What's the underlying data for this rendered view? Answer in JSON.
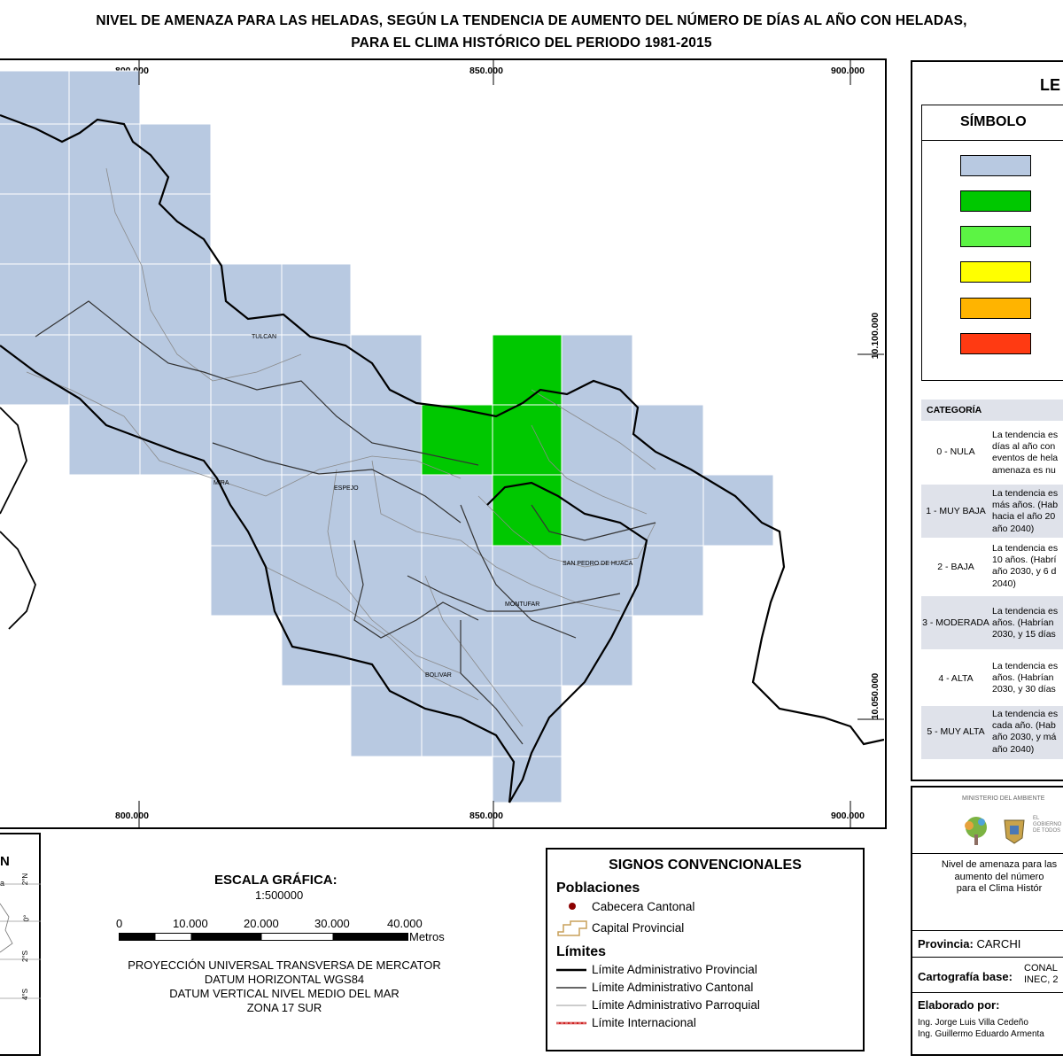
{
  "title": {
    "line1": "NIVEL DE AMENAZA PARA LAS HELADAS, SEGÚN LA TENDENCIA DE AUMENTO DEL NÚMERO DE DÍAS AL AÑO CON HELADAS,",
    "line2": "PARA EL CLIMA HISTÓRICO DEL PERIODO 1981-2015"
  },
  "map": {
    "x_ticks": [
      "800.000",
      "850.000",
      "900.000"
    ],
    "y_ticks": [
      "10.100.000",
      "10.050.000"
    ],
    "labels": {
      "tulcan": "TULCAN",
      "mira": "MIRA",
      "espejo": "ESPEJO",
      "san_pedro": "SAN PEDRO DE HUACA",
      "montufar": "MONTUFAR",
      "bolivar": "BOLIVAR"
    },
    "colors": {
      "nula": "#b8c9e1",
      "muy_baja": "#00c800",
      "baja": "#5cf444",
      "moderada": "#ffff00",
      "alta": "#ffb400",
      "muy_alta": "#ff3a12"
    }
  },
  "inset": {
    "title": "N",
    "label": "a",
    "lat_ticks": [
      "2°N",
      "0°",
      "2°S",
      "4°S"
    ]
  },
  "scale": {
    "title": "ESCALA GRÁFICA:",
    "ratio": "1:500000",
    "ticks": [
      "0",
      "10.000",
      "20.000",
      "30.000",
      "40.000"
    ],
    "unit": "Metros",
    "proj1": "PROYECCIÓN UNIVERSAL TRANSVERSA DE MERCATOR",
    "proj2": "DATUM HORIZONTAL WGS84",
    "proj3": "DATUM VERTICAL NIVEL MEDIO DEL MAR",
    "proj4": "ZONA 17 SUR"
  },
  "signs": {
    "title": "SIGNOS CONVENCIONALES",
    "poblaciones": "Poblaciones",
    "cabecera": "Cabecera Cantonal",
    "capital": "Capital Provincial",
    "limites": "Límites",
    "provincial": "Límite Administrativo Provincial",
    "cantonal": "Límite Administrativo Cantonal",
    "parroquial": "Límite Administrativo Parroquial",
    "internacional": "Límite Internacional"
  },
  "legend": {
    "title": "LE",
    "symbol_header": "SÍMBOLO",
    "category_header": "CATEGORÍA",
    "rows": [
      {
        "cat": "0 - NULA",
        "desc": [
          "La tendencia es",
          "días al año con",
          "eventos de hela",
          "amenaza es nu"
        ]
      },
      {
        "cat": "1 - MUY BAJA",
        "desc": [
          "La tendencia es",
          "más años. (Hab",
          "hacia el año 20",
          "año 2040)"
        ]
      },
      {
        "cat": "2 - BAJA",
        "desc": [
          "La tendencia es",
          "10 años. (Habrí",
          "año 2030, y 6 d",
          "2040)"
        ]
      },
      {
        "cat": "3 - MODERADA",
        "desc": [
          "La tendencia es",
          "años. (Habrían",
          "2030, y 15 días"
        ]
      },
      {
        "cat": "4 - ALTA",
        "desc": [
          "La tendencia es",
          "años. (Habrían",
          "2030, y 30 días"
        ]
      },
      {
        "cat": "5 - MUY ALTA",
        "desc": [
          "La tendencia es",
          "cada año. (Hab",
          "año 2030, y má",
          "año 2040)"
        ]
      }
    ]
  },
  "info": {
    "ministerio": "MINISTERIO DEL AMBIENTE",
    "gobierno1": "EL",
    "gobierno2": "GOBIERNO",
    "gobierno3": "DE TODOS",
    "map_title1": "Nivel de amenaza para las",
    "map_title2": "aumento del número",
    "map_title3": "para el Clima Histór",
    "provincia_label": "Provincia:",
    "provincia_value": "CARCHI",
    "cartografia_label": "Cartografía base:",
    "cartografia_value1": "CONAL",
    "cartografia_value2": "INEC, 2",
    "elaborado_label": "Elaborado por:",
    "autor1": "Ing. Jorge Luis Villa Cedeño",
    "autor2": "Ing. Guillermo Eduardo Armenta"
  }
}
